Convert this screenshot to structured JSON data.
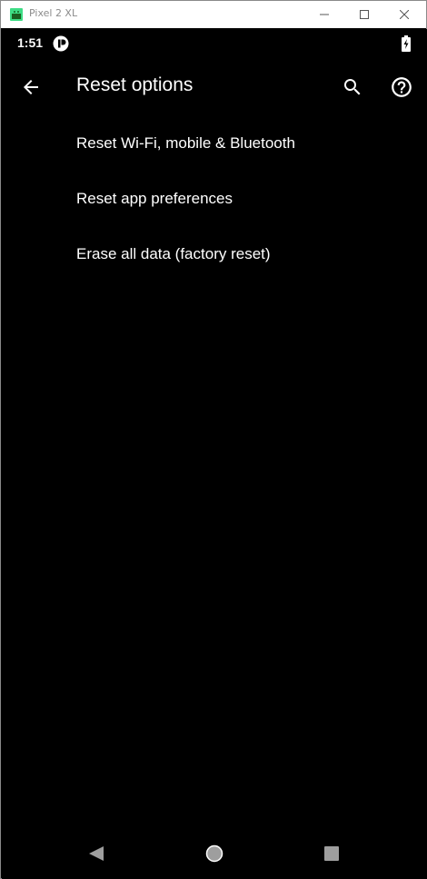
{
  "window": {
    "title": "Pixel 2 XL",
    "app_icon": "android-emulator-icon",
    "buttons": [
      "minimize-icon",
      "maximize-icon",
      "close-icon"
    ]
  },
  "status_bar": {
    "time": "1:51",
    "notification_icon": "notification-icon",
    "battery_icon": "battery-charging-icon"
  },
  "toolbar": {
    "title": "Reset options",
    "back_icon": "arrow-back-icon",
    "search_icon": "search-icon",
    "help_icon": "help-icon"
  },
  "options": [
    {
      "label": "Reset Wi-Fi, mobile & Bluetooth"
    },
    {
      "label": "Reset app preferences"
    },
    {
      "label": "Erase all data (factory reset)"
    }
  ],
  "nav_bar": {
    "back_icon": "nav-back-icon",
    "home_icon": "nav-home-icon",
    "recents_icon": "nav-recents-icon"
  },
  "colors": {
    "background": "#000000",
    "text": "#ffffff",
    "nav_icons": "#9e9e9e",
    "titlebar": "#ffffff"
  }
}
